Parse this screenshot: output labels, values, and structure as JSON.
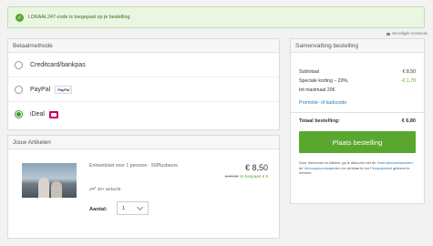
{
  "alert": {
    "message": "LOKAAL247-code is toegepast op je bestelling"
  },
  "secure": {
    "label": "Beveiligde transactie"
  },
  "payment": {
    "title": "Betaalmethode",
    "options": [
      {
        "label": "Creditcard/bankpas",
        "selected": false
      },
      {
        "label": "PayPal",
        "badge": "PayPal",
        "selected": false
      },
      {
        "label": "iDeal",
        "selected": true
      }
    ]
  },
  "items": {
    "title": "Jouw Artikelen",
    "product": {
      "name": "Entreeticket voor 1 persoon - 50Plusbeurs",
      "price": "€ 8,50",
      "old_price": "€ 17,00",
      "savings": "Je bespaart € 9",
      "sold": "20+ verkocht",
      "quantity_label": "Aantal:",
      "quantity": "1"
    }
  },
  "summary": {
    "title": "Samenvatting bestelling",
    "subtotal_label": "Subtotaal",
    "subtotal_value": "€ 8,50",
    "discount_label": "Speciale korting – 20%,",
    "discount_value": "-€ 1,70",
    "discount_note": "tot maximaal 20€",
    "promo_link": "Promotie- of kadocode",
    "total_label": "Totaal bestelling:",
    "total_value": "€ 6,80",
    "order_button": "Plaats bestelling",
    "terms_prefix": "Door hierboven te klikken, ga ik akkoord met de",
    "terms_link1": "Gebruiksvoorwaarden",
    "terms_mid": ", de",
    "terms_link2": "Verkoopsvoorwaarden",
    "terms_and": "en verklaar ik het",
    "terms_link3": "Privacybeleid",
    "terms_suffix": "gelezen te hebben."
  },
  "colors": {
    "accent": "#5aa72f",
    "link": "#2a7ab8",
    "ideal": "#cc0066"
  }
}
